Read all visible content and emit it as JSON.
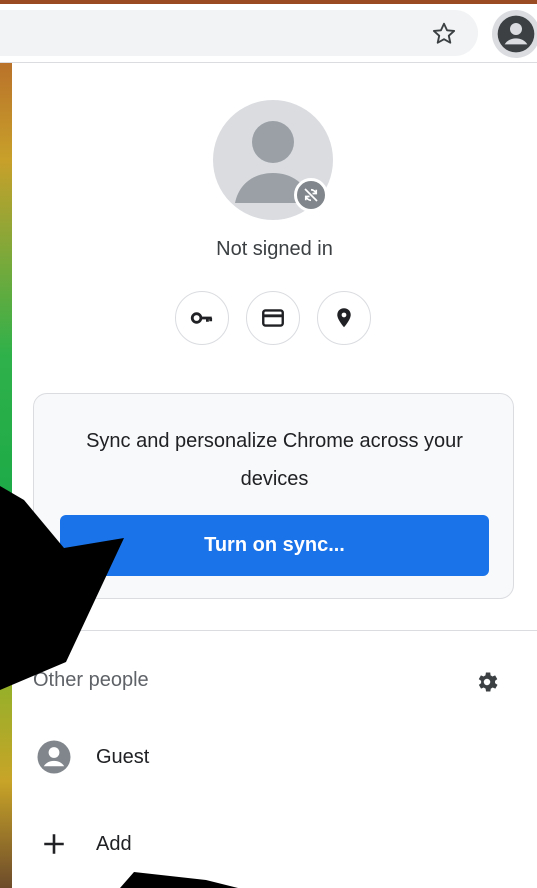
{
  "toolbar": {
    "star_icon": "star-outline-icon",
    "profile_icon": "account-circle-icon"
  },
  "profile": {
    "status": "Not signed in",
    "quick_actions": [
      {
        "name": "passwords",
        "icon": "key-icon"
      },
      {
        "name": "payment-methods",
        "icon": "credit-card-icon"
      },
      {
        "name": "addresses",
        "icon": "location-pin-icon"
      }
    ]
  },
  "sync": {
    "text": "Sync and personalize Chrome across your devices",
    "button_label": "Turn on sync..."
  },
  "other_people": {
    "title": "Other people",
    "items": [
      {
        "label": "Guest",
        "icon": "account-circle-icon"
      },
      {
        "label": "Add",
        "icon": "plus-icon"
      }
    ]
  },
  "colors": {
    "accent": "#1a73e8",
    "text": "#202124",
    "muted": "#5f6368",
    "border": "#dadce0"
  }
}
